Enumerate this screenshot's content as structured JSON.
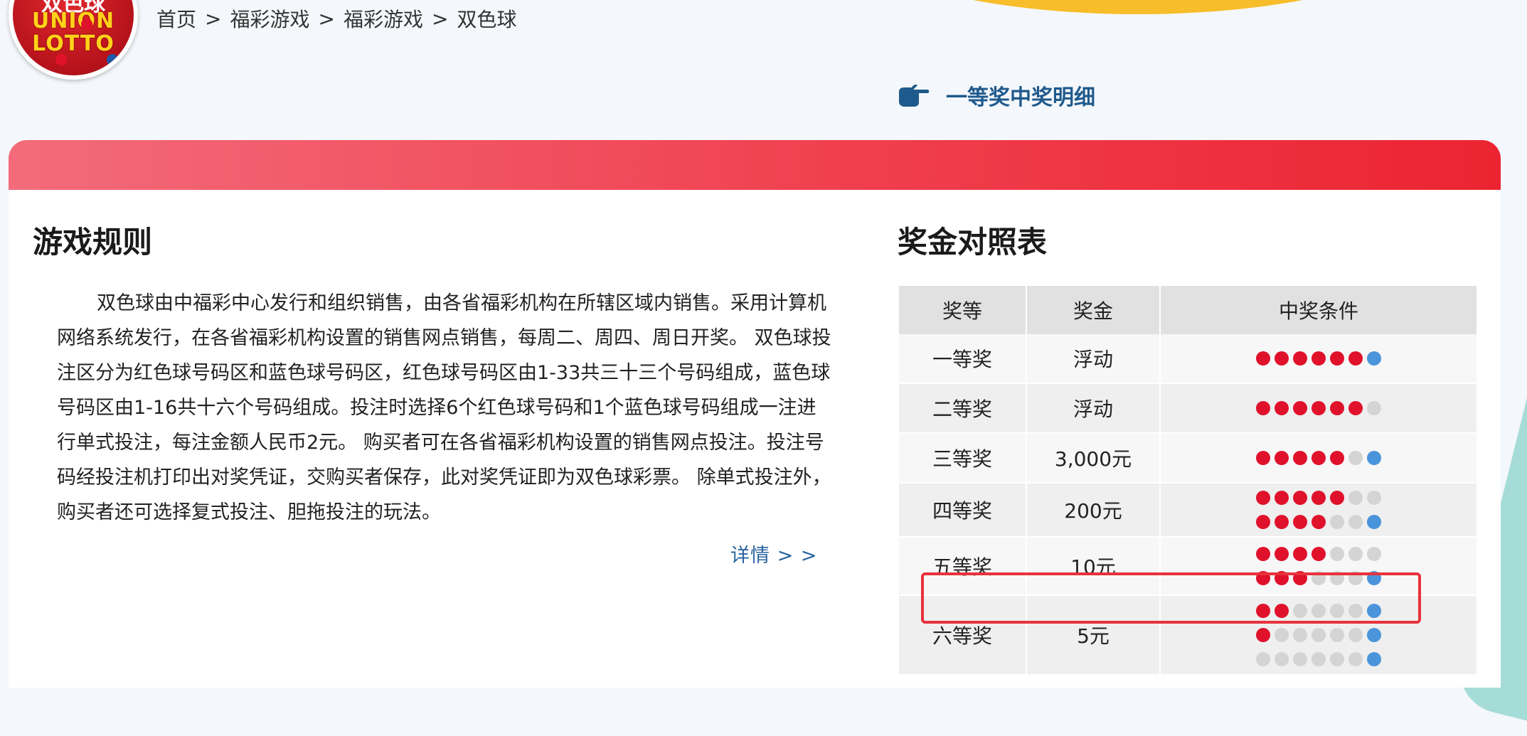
{
  "logo": {
    "text_top": "双色球",
    "text_line1": "UNION",
    "text_line2": "LOTTO"
  },
  "breadcrumb": {
    "items": [
      "首页",
      "福彩游戏",
      "福彩游戏",
      "双色球"
    ],
    "separator": ">"
  },
  "winner_link": {
    "label": "一等奖中奖明细",
    "icon": "pointing-hand-icon"
  },
  "rules": {
    "title": "游戏规则",
    "paragraph": "双色球由中福彩中心发行和组织销售，由各省福彩机构在所辖区域内销售。采用计算机网络系统发行，在各省福彩机构设置的销售网点销售，每周二、周四、周日开奖。 双色球投注区分为红色球号码区和蓝色球号码区，红色球号码区由1-33共三十三个号码组成，蓝色球号码区由1-16共十六个号码组成。投注时选择6个红色球号码和1个蓝色球号码组成一注进行单式投注，每注金额人民币2元。 购买者可在各省福彩机构设置的销售网点投注。投注号码经投注机打印出对奖凭证，交购买者保存，此对奖凭证即为双色球彩票。 除单式投注外，购买者还可选择复式投注、胆拖投注的玩法。",
    "more_label": "详情 > >"
  },
  "prize_table": {
    "title": "奖金对照表",
    "headers": [
      "奖等",
      "奖金",
      "中奖条件"
    ],
    "rows": [
      {
        "level": "一等奖",
        "amount": "浮动",
        "conditions": [
          [
            "red",
            "red",
            "red",
            "red",
            "red",
            "red",
            "blue"
          ]
        ]
      },
      {
        "level": "二等奖",
        "amount": "浮动",
        "conditions": [
          [
            "red",
            "red",
            "red",
            "red",
            "red",
            "red",
            "grey"
          ]
        ]
      },
      {
        "level": "三等奖",
        "amount": "3,000元",
        "conditions": [
          [
            "red",
            "red",
            "red",
            "red",
            "red",
            "grey",
            "blue"
          ]
        ],
        "highlighted": true
      },
      {
        "level": "四等奖",
        "amount": "200元",
        "conditions": [
          [
            "red",
            "red",
            "red",
            "red",
            "red",
            "grey",
            "grey"
          ],
          [
            "red",
            "red",
            "red",
            "red",
            "grey",
            "grey",
            "blue"
          ]
        ]
      },
      {
        "level": "五等奖",
        "amount": "10元",
        "conditions": [
          [
            "red",
            "red",
            "red",
            "red",
            "grey",
            "grey",
            "grey"
          ],
          [
            "red",
            "red",
            "red",
            "grey",
            "grey",
            "grey",
            "blue"
          ]
        ]
      },
      {
        "level": "六等奖",
        "amount": "5元",
        "conditions": [
          [
            "red",
            "red",
            "grey",
            "grey",
            "grey",
            "grey",
            "blue"
          ],
          [
            "red",
            "grey",
            "grey",
            "grey",
            "grey",
            "grey",
            "blue"
          ],
          [
            "grey",
            "grey",
            "grey",
            "grey",
            "grey",
            "grey",
            "blue"
          ]
        ]
      }
    ]
  },
  "colors": {
    "header_gradient_start": "#f36b7a",
    "header_gradient_end": "#ec2432",
    "ball_red": "#e0112b",
    "ball_blue": "#4a94db",
    "ball_grey": "#d4d4d4",
    "link_blue": "#1f5a8c",
    "highlight_border": "#e8323c"
  }
}
